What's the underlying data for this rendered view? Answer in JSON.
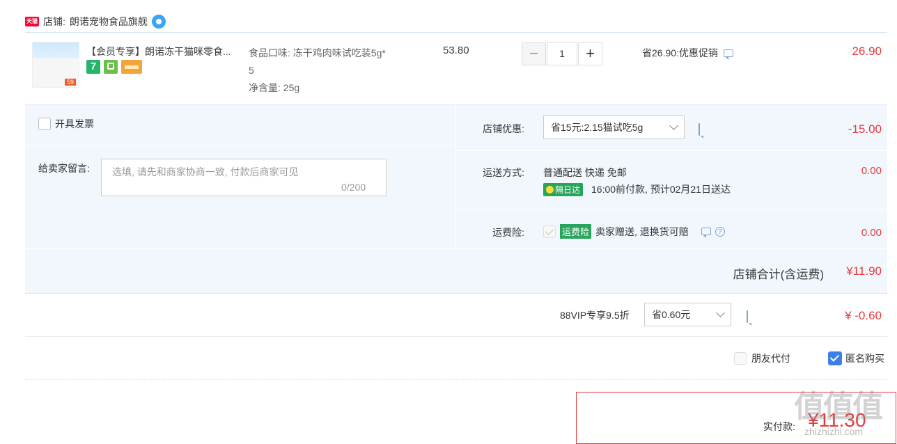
{
  "shop": {
    "tmall_badge": "天猫",
    "label": "店铺:",
    "name": "朗诺宠物食品旗舰"
  },
  "item": {
    "title": "【会员专享】朗诺冻干猫咪零食...",
    "thumb_price_tag": "59",
    "badges": [
      "7",
      "bag-icon",
      "card-icon"
    ],
    "sku_line1": "食品口味: 冻干鸡肉味试吃装5g*",
    "sku_line2": "5",
    "sku_line3": "净含量: 25g",
    "unit_price": "53.80",
    "quantity": "1",
    "minus": "−",
    "plus": "+",
    "promo": "省26.90:优惠促销",
    "subtotal": "26.90"
  },
  "invoice": {
    "label": "开具发票"
  },
  "message": {
    "label": "给卖家留言:",
    "placeholder": "选填, 请先和商家协商一致, 付款后商家可见",
    "counter": "0/200"
  },
  "shop_discount": {
    "label": "店铺优惠:",
    "selected": "省15元:2.15猫试吃5g",
    "value": "-15.00"
  },
  "shipping": {
    "label": "运送方式:",
    "method": "普通配送 快递 免邮",
    "badge": "隔日达",
    "eta": "16:00前付款, 预计02月21日送达",
    "value": "0.00"
  },
  "insurance": {
    "label": "运费险:",
    "badge": "运费险",
    "text": "卖家赠送, 退换货可赔",
    "help": "?",
    "value": "0.00"
  },
  "shop_total": {
    "label": "店铺合计(含运费)",
    "value": "¥11.90"
  },
  "vip": {
    "label": "88VIP专享9.5折",
    "selected": "省0.60元",
    "value": "¥ -0.60"
  },
  "options": {
    "friend_pay": "朋友代付",
    "anonymous": "匿名购买",
    "anonymous_checked": true
  },
  "payment": {
    "label": "实付款:",
    "value": "¥11.30"
  },
  "watermark": {
    "text": "值值值",
    "site": "zhizhizhi.com"
  },
  "colors": {
    "accent_red": "#e4393c",
    "panel_bg": "#f1f7fd",
    "green": "#27a55b",
    "checkbox_blue": "#3e7ee9"
  }
}
